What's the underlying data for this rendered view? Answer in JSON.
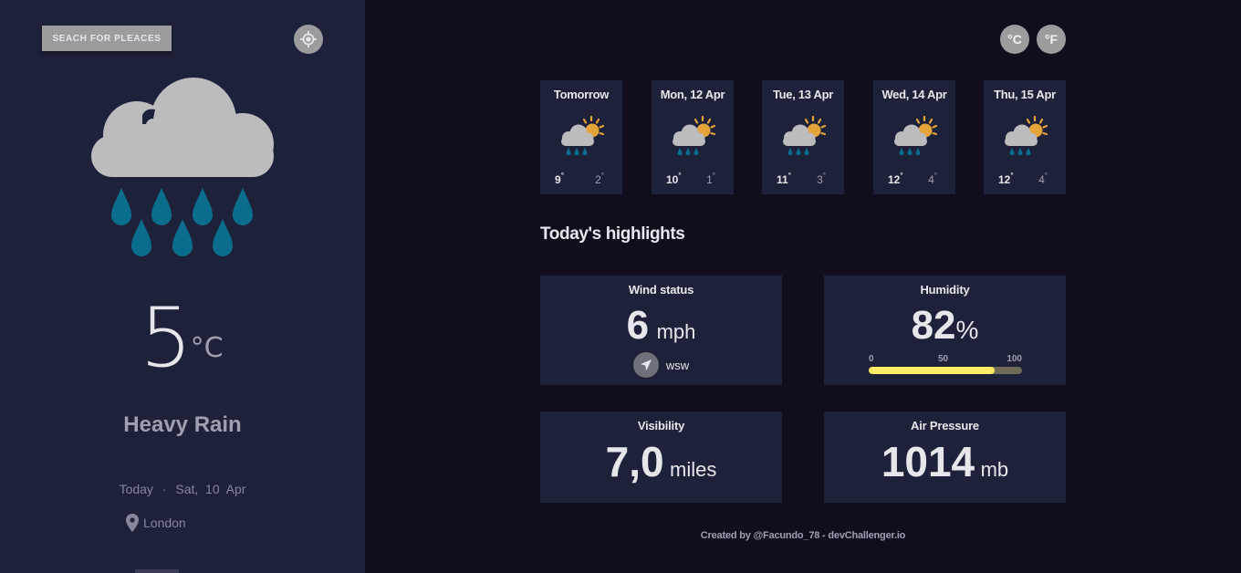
{
  "sidebar": {
    "search_label": "SEACH FOR PLEACES",
    "location_button_icon": "crosshair-icon",
    "weather_icon": "heavy-rain-icon",
    "temperature": "5",
    "temperature_unit": "°C",
    "condition": "Heavy Rain",
    "date_prefix": "Today",
    "date_separator": "·",
    "date": "Sat,  10  Apr",
    "location": "London",
    "location_icon": "map-pin-icon"
  },
  "units": {
    "celsius_label": "°C",
    "fahrenheit_label": "°F"
  },
  "forecast": [
    {
      "date": "Tomorrow",
      "icon": "light-rain-sun-icon",
      "max": "9",
      "min": "2"
    },
    {
      "date": "Mon, 12 Apr",
      "icon": "light-rain-sun-icon",
      "max": "10",
      "min": "1"
    },
    {
      "date": "Tue, 13 Apr",
      "icon": "light-rain-sun-icon",
      "max": "11",
      "min": "3"
    },
    {
      "date": "Wed, 14 Apr",
      "icon": "light-rain-sun-icon",
      "max": "12",
      "min": "4"
    },
    {
      "date": "Thu, 15 Apr",
      "icon": "light-rain-sun-icon",
      "max": "12",
      "min": "4"
    }
  ],
  "highlights": {
    "title": "Today's highlights",
    "wind": {
      "label": "Wind status",
      "value": "6",
      "unit": "mph",
      "direction": "wsw",
      "direction_icon": "navigation-arrow-icon"
    },
    "humidity": {
      "label": "Humidity",
      "value": "82",
      "unit": "%",
      "scale_min": "0",
      "scale_mid": "50",
      "scale_max": "100",
      "fill_percent": 82
    },
    "visibility": {
      "label": "Visibility",
      "value": "7,0",
      "unit": "miles"
    },
    "pressure": {
      "label": "Air Pressure",
      "value": "1014",
      "unit": "mb"
    }
  },
  "footer": "Created by @Facundo_78 - devChallenger.io",
  "colors": {
    "background": "#100e1d",
    "panel": "#1e213a",
    "button_gray": "#9c9c9e",
    "humidity_bar": "#ffec65",
    "rain_drop": "#0b6d8c",
    "cloud": "#bcbcbf",
    "sun": "#e5a439"
  }
}
